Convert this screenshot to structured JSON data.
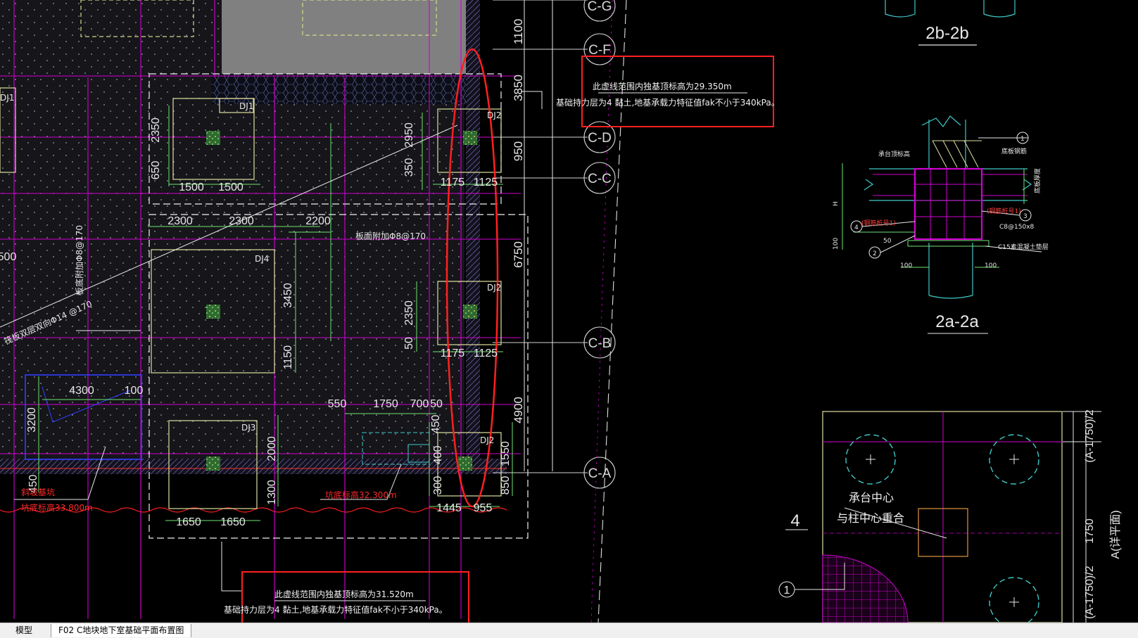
{
  "tabs": [
    {
      "label": "模型"
    },
    {
      "label": "F02 C地块地下室基础平面布置图"
    }
  ],
  "colors": {
    "background": "#000000",
    "hatch_fill": "#1e1e24",
    "highlight_box": "#ff2020",
    "magenta_line": "#d200d2",
    "green_line": "#6fe46f",
    "cyan_line": "#46c8c8"
  },
  "plan": {
    "grid_axes": [
      "C-G",
      "C-F",
      "C-D",
      "C-C",
      "C-B",
      "C-A"
    ],
    "dims_vertical_right": [
      "1100",
      "3850",
      "950",
      "6750",
      "4900"
    ],
    "footing_labels": [
      "DJ1",
      "DJ1",
      "DJ2",
      "DJ4",
      "DJ2",
      "DJ3",
      "DJ2"
    ],
    "dims": {
      "d2350a": "2350",
      "d650": "650",
      "d1500a": "1500",
      "d1500b": "1500",
      "d2950": "2950",
      "d350": "350",
      "d1175a": "1175",
      "d1125a": "1125",
      "d2300a": "2300",
      "d2300b": "2300",
      "d2200": "2200",
      "d3450": "3450",
      "d1150": "1150",
      "d2350b": "2350",
      "d50a": "50",
      "d1175b": "1175",
      "d1125b": "1125",
      "d4300": "4300",
      "d100": "100",
      "d3200": "3200",
      "d550": "550",
      "d1750": "1750",
      "d700": "700",
      "d50b": "50",
      "d450a": "450",
      "d2000": "2000",
      "d1300": "1300",
      "d400": "400",
      "d300": "300",
      "d1550": "1550",
      "d850": "850",
      "d1445": "1445",
      "d955": "955",
      "d1650a": "1650",
      "d1650b": "1650",
      "d450b": "450",
      "d500": "500"
    },
    "rebar_notes": {
      "top_slab": "板面附加Φ8@170",
      "left_slab_v": "板底附加Φ8@170",
      "left_diag": "筏板双层双向Φ14 @170"
    },
    "red_notes": {
      "slope_label": "斜坡基坑",
      "left_elev": "坑底标高33.800m",
      "mid_elev": "坑底标高32.300m"
    }
  },
  "annotations": {
    "top_box": {
      "line1": "此虚线范围内独基顶标高为29.350m",
      "line2": "基础持力层为4 黏土,地基承载力特征值fak不小于340kPa。"
    },
    "bottom_box": {
      "line1": "此虚线范围内独基顶标高为31.520m",
      "line2": "基础持力层为4 黏土,地基承载力特征值fak不小于340kPa。"
    }
  },
  "sections": {
    "title_top": "2b-2b",
    "title_mid": "2a-2a",
    "detail_labels": {
      "bearing_top": "承台顶标高",
      "slab_bar": "底板钢筋",
      "h": "H",
      "d100a": "100",
      "d100b": "100",
      "d100c": "100",
      "d50": "50",
      "callout1": "1",
      "callout2": "2",
      "callout3": "3",
      "callout4": "4",
      "steel_left": "(钢筋桩号1)",
      "steel_right": "(钢筋桩号1)",
      "cap_bar": "C8@150x8",
      "c15": "C15素混凝土垫层",
      "side_note": "底板厚度"
    },
    "pile_cap": {
      "label4": "4",
      "center_note1": "承台中心",
      "center_note2": "与柱中心重合",
      "dim_top": "(A-1750)/2",
      "dim_mid": "1750",
      "dim_side": "A(详平面)",
      "dim_bottom": "(A-1750)/2",
      "callout": "1"
    }
  }
}
